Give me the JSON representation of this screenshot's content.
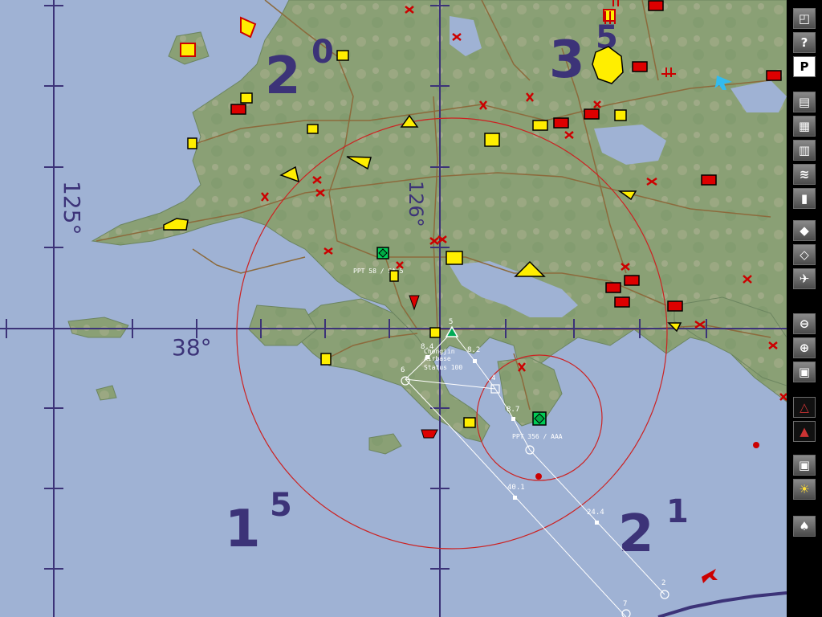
{
  "sectors": [
    {
      "major": "2",
      "minor": "0"
    },
    {
      "major": "3",
      "minor": "5"
    },
    {
      "major": "1",
      "minor": "5"
    },
    {
      "major": "2",
      "minor": "1"
    }
  ],
  "grid_labels": {
    "lon_left": "125°",
    "lon_mid": "126°",
    "lat": "38°"
  },
  "labels": {
    "ppt58": "PPT 58 / SA-5",
    "airbase_name": "Chongjin",
    "airbase_type": "Airbase",
    "airbase_status": "Status 100",
    "ppt356": "PPT 356 / AAA"
  },
  "waypoints": [
    "5",
    "4",
    "6",
    "2",
    "7"
  ],
  "distances": [
    "8.4",
    "8.2",
    "8.7",
    "40.1",
    "24.4"
  ],
  "toolbar": {
    "help_label": "?",
    "p_label": "P"
  },
  "colors": {
    "water": "#9fb2d4",
    "land": "#8aa075",
    "road": "#8c6a3c",
    "red_unit": "#dd0000",
    "yellow_unit": "#ffff00",
    "grid": "#3c3378",
    "range_ring": "#cc2222"
  }
}
